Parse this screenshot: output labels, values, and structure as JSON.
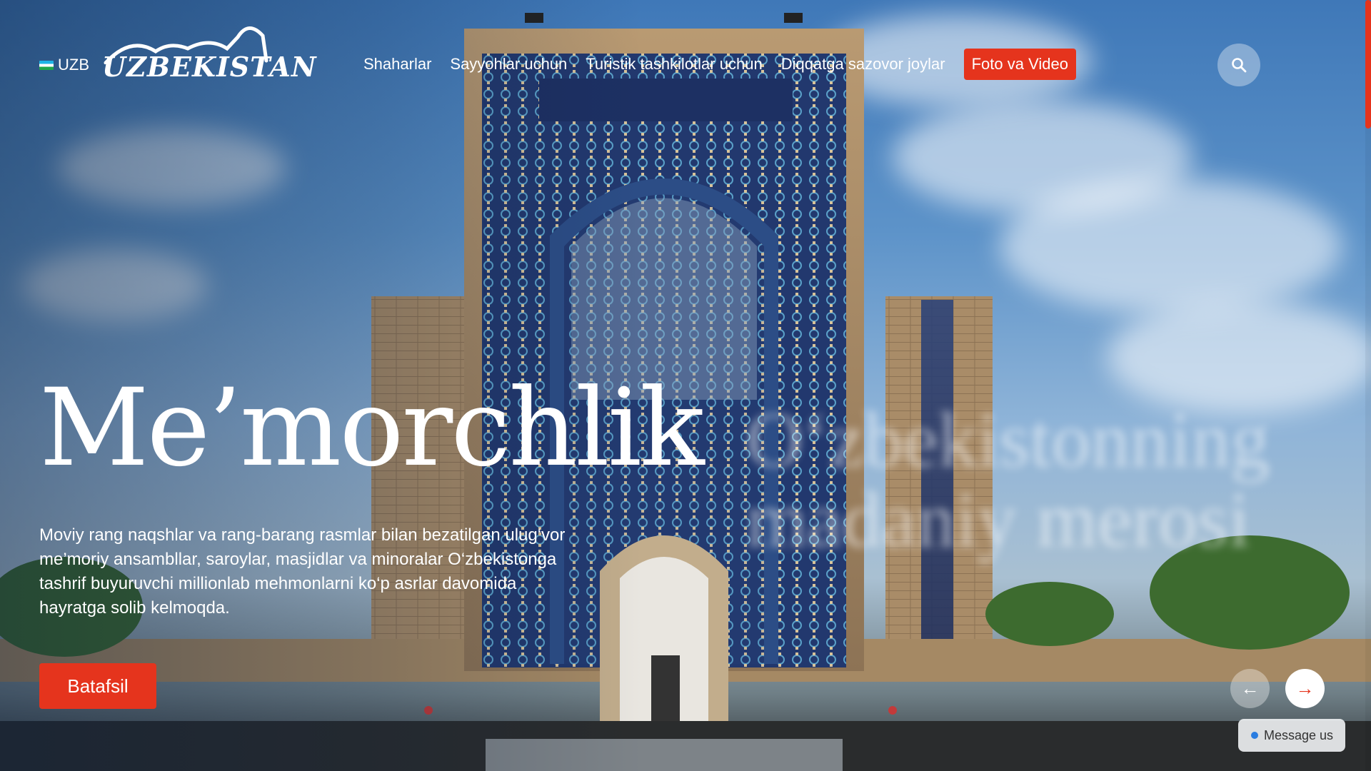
{
  "header": {
    "language": "UZB",
    "logo_text": "UZBEKISTAN",
    "nav": [
      {
        "label": "Shaharlar"
      },
      {
        "label": "Sayyohlar uchun"
      },
      {
        "label": "Turistik tashkilotlar uchun"
      },
      {
        "label": "Diqqatga sazovor joylar"
      }
    ],
    "cta_label": "Foto va Video",
    "search_icon": "search-icon"
  },
  "hero": {
    "title": "Me’morchlik",
    "description": "Moviy rang naqshlar va rang-barang rasmlar bilan bezatilgan ulug‘vor me’moriy ansambllar, saroylar, masjidlar va minoralar O‘zbekistonga tashrif buyuruvchi millionlab mehmonlarni ko‘p asrlar davomida hayratga solib kelmoqda.",
    "button_label": "Batafsil",
    "next_slide_preview": "O‘zbekistonning madaniy merosi"
  },
  "slider": {
    "prev_icon": "←",
    "next_icon": "→"
  },
  "chat": {
    "label": "Message us"
  },
  "colors": {
    "accent": "#e5341d",
    "text": "#ffffff"
  }
}
